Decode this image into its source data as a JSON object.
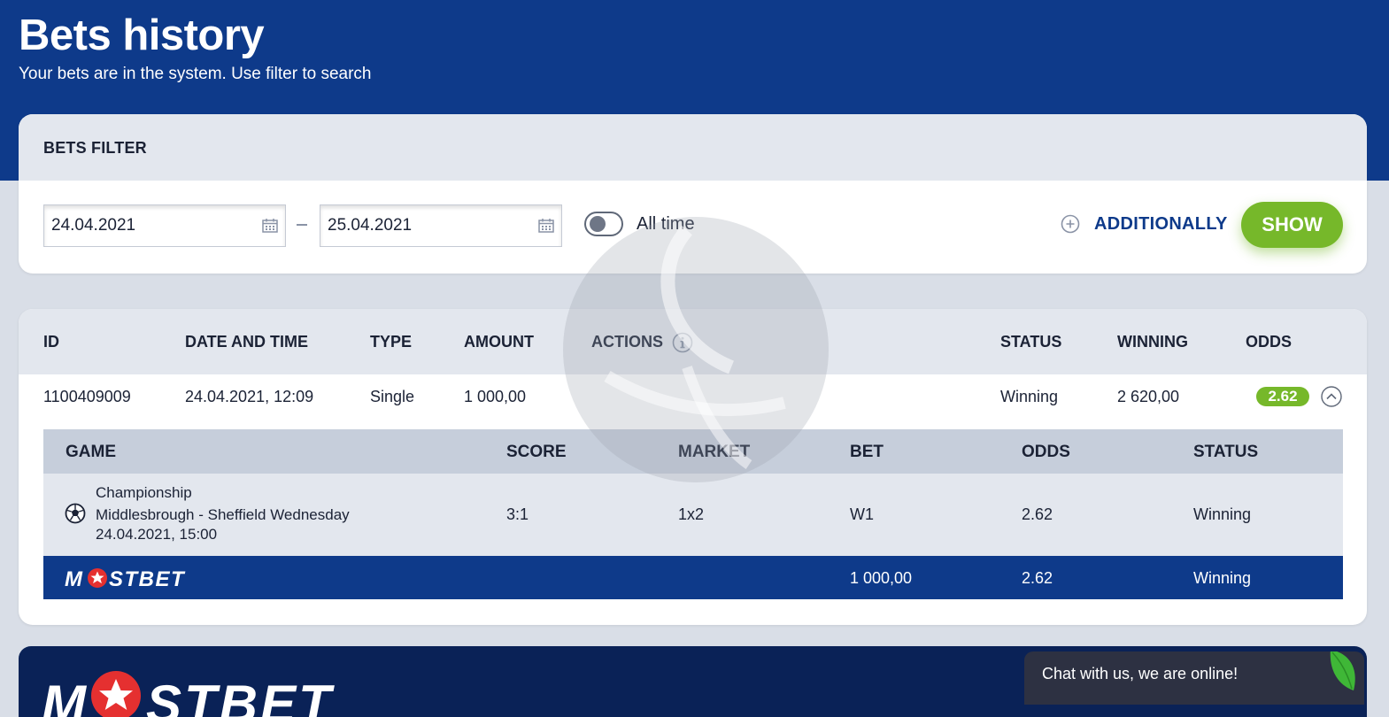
{
  "header": {
    "title": "Bets history",
    "subtitle": "Your bets are in the system. Use filter to search"
  },
  "filter": {
    "title": "BETS FILTER",
    "date_from": "24.04.2021",
    "date_to": "25.04.2021",
    "all_time_label": "All time",
    "all_time_enabled": false,
    "additionally_label": "ADDITIONALLY",
    "show_label": "SHOW"
  },
  "history": {
    "columns": {
      "id": "ID",
      "date_time": "DATE AND TIME",
      "type": "TYPE",
      "amount": "AMOUNT",
      "actions": "ACTIONS",
      "status": "STATUS",
      "winning": "WINNING",
      "odds": "ODDS"
    },
    "row": {
      "id": "1100409009",
      "date_time": "24.04.2021, 12:09",
      "type": "Single",
      "amount": "1 000,00",
      "status": "Winning",
      "winning": "2 620,00",
      "odds": "2.62"
    },
    "detail": {
      "columns": {
        "game": "GAME",
        "score": "SCORE",
        "market": "MARKET",
        "bet": "BET",
        "odds": "ODDS",
        "status": "STATUS"
      },
      "event": {
        "league": "Championship",
        "match": "Middlesbrough - Sheffield Wednesday",
        "start": "24.04.2021, 15:00",
        "score": "3:1",
        "market": "1x2",
        "bet": "W1",
        "odds": "2.62",
        "status": "Winning"
      },
      "footer": {
        "logo_text": "MOSTBET",
        "amount": "1 000,00",
        "odds": "2.62",
        "status": "Winning"
      }
    }
  },
  "bottom": {
    "logo_text": "MOSTBET"
  },
  "chat": {
    "text": "Chat with us, we are online!"
  },
  "colors": {
    "brand_blue": "#0e3a8a",
    "accent_green": "#76b82a",
    "logo_star": "#e53030"
  },
  "icons": [
    "calendar-icon",
    "plus-circle-icon",
    "info-icon",
    "chevron-up-icon",
    "soccer-ball-icon",
    "star-icon",
    "leaf-icon"
  ]
}
